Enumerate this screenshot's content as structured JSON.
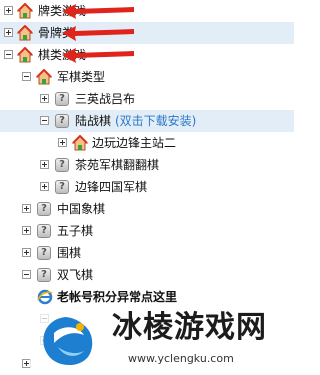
{
  "tree": {
    "rows": [
      {
        "label": "牌类游戏",
        "icon": "house-icon",
        "toggle": "plus"
      },
      {
        "label": "骨牌类",
        "icon": "house-icon",
        "toggle": "plus"
      },
      {
        "label": "棋类游戏",
        "icon": "house-icon",
        "toggle": "minus"
      },
      {
        "label": "军棋类型",
        "icon": "house-icon",
        "toggle": "minus"
      },
      {
        "label": "三英战吕布",
        "icon": "game-icon",
        "toggle": "plus"
      },
      {
        "label": "陆战棋",
        "extra": "(双击下载安装)",
        "icon": "game-icon",
        "toggle": "minus"
      },
      {
        "label": "边玩边锋主站二",
        "icon": "house-icon",
        "toggle": "plus"
      },
      {
        "label": "茶苑军棋翻翻棋",
        "icon": "game-icon",
        "toggle": "plus"
      },
      {
        "label": "边锋四国军棋",
        "icon": "game-icon",
        "toggle": "plus"
      },
      {
        "label": "中国象棋",
        "icon": "game-icon",
        "toggle": "plus"
      },
      {
        "label": "五子棋",
        "icon": "game-icon",
        "toggle": "plus"
      },
      {
        "label": "围棋",
        "icon": "game-icon",
        "toggle": "plus"
      },
      {
        "label": "双飞棋",
        "icon": "game-icon",
        "toggle": "minus"
      },
      {
        "label": "老帐号积分异常点这里",
        "icon": "ie-icon"
      }
    ]
  },
  "watermark": {
    "text": "冰棱游戏网",
    "url": "www.yclengku.com"
  },
  "colors": {
    "selected_row": "#e3edf8",
    "link": "#2a78c8",
    "arrow": "#e0241b"
  }
}
